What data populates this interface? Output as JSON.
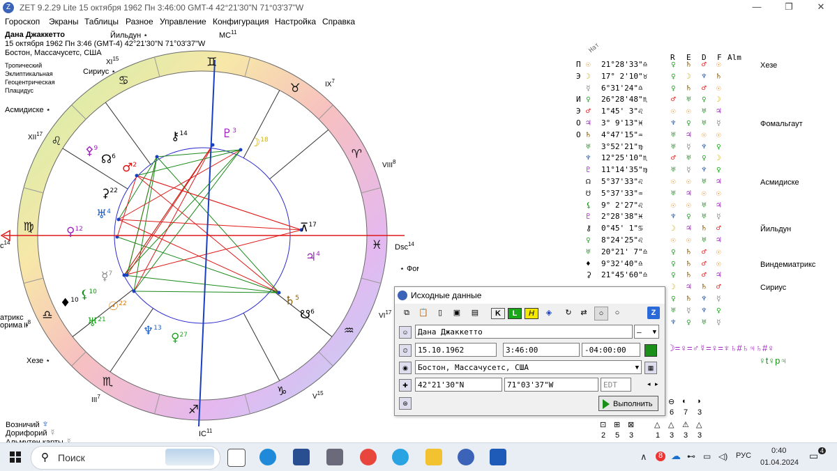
{
  "window": {
    "title": "ZET 9.2.29 Lite    15 октября 1962  Пн   3:46:00 GMT-4 42°21'30\"N  71°03'37\"W",
    "minimize": "—",
    "restore": "❐",
    "close": "✕"
  },
  "menu": [
    "Гороскоп",
    "Экраны",
    "Таблицы",
    "Разное",
    "Управление",
    "Конфигурация",
    "Настройка",
    "Справка"
  ],
  "chart_info": {
    "name": "Дана Джаккетто",
    "date_line": "15 октября 1962  Пн   3:46 (GMT-4) 42°21'30\"N  71°03'37\"W",
    "place": "Бостон, Массачусетс, США",
    "settings": [
      "Тропический",
      "Эклиптикальная",
      "Геоцентрическая",
      "Плацидус"
    ]
  },
  "wheel": {
    "star_labels": [
      {
        "id": "yildun",
        "text": "Йильдун ⋆"
      },
      {
        "id": "sirius",
        "text": "Сириус ⋆"
      },
      {
        "id": "asmidiske",
        "text": "Асмидиске ⋆"
      },
      {
        "id": "fomalhaut",
        "text": "⋆ Фомальгаут"
      },
      {
        "id": "atriks",
        "text": "атрикс"
      },
      {
        "id": "orima",
        "text": "орима ⋆"
      },
      {
        "id": "heze",
        "text": "Хезе ⋆"
      }
    ],
    "angle_labels": {
      "mc": "MC",
      "mc_deg": "11",
      "ic": "IC",
      "ic_deg": "11",
      "asc": "c",
      "asc_deg": "14",
      "dsc": "Dsc",
      "dsc_deg": "14"
    },
    "house_labels": [
      {
        "num": "XI",
        "deg": "15"
      },
      {
        "num": "IX",
        "deg": "7"
      },
      {
        "num": "XII",
        "deg": "17"
      },
      {
        "num": "VIII",
        "deg": "8"
      },
      {
        "num": "VI",
        "deg": "17"
      },
      {
        "num": "III",
        "deg": "7"
      },
      {
        "num": "V",
        "deg": "15"
      },
      {
        "num": "II",
        "deg": "8"
      }
    ],
    "signs_ring": [
      "♊",
      "♉",
      "♈",
      "♓",
      "♒",
      "♑",
      "♐",
      "♏",
      "♎",
      "♍",
      "♌",
      "♋"
    ],
    "planets": [
      {
        "glyph": "☉",
        "deg": "22",
        "color": "#e07a00"
      },
      {
        "glyph": "☽",
        "deg": "18",
        "color": "#d4b000"
      },
      {
        "glyph": "☿",
        "deg": "7",
        "color": "#888888"
      },
      {
        "glyph": "♀",
        "deg": "27",
        "color": "#1aa81a"
      },
      {
        "glyph": "♂",
        "deg": "2",
        "color": "#e01010"
      },
      {
        "glyph": "♃",
        "deg": "4",
        "color": "#a020c0"
      },
      {
        "glyph": "♄",
        "deg": "5",
        "color": "#8b5a00"
      },
      {
        "glyph": "♅",
        "deg": "4",
        "color": "#1a5fc8"
      },
      {
        "glyph": "♆",
        "deg": "13",
        "color": "#1a5fc8"
      },
      {
        "glyph": "♇",
        "deg": "3",
        "color": "#a020c0"
      },
      {
        "glyph": "☊",
        "deg": "6",
        "color": "#000000"
      },
      {
        "glyph": "☋",
        "deg": "6",
        "color": "#000000"
      },
      {
        "glyph": "⚸",
        "deg": "10",
        "color": "#1a8f1a"
      },
      {
        "glyph": "⚳",
        "deg": "22",
        "color": "#000000"
      },
      {
        "glyph": "♀",
        "deg": "12",
        "color": "#a020c0"
      },
      {
        "glyph": "⚷",
        "deg": "14",
        "color": "#000000"
      },
      {
        "glyph": "♅",
        "deg": "21",
        "color": "#1aa81a"
      },
      {
        "glyph": "⚴",
        "deg": "9",
        "color": "#a020c0"
      },
      {
        "glyph": "⊼",
        "deg": "17",
        "color": "#000000"
      },
      {
        "glyph": "♦",
        "deg": "10",
        "color": "#000000"
      }
    ]
  },
  "table": {
    "header_nat": "Нат",
    "col_headers": [
      "R",
      "E",
      "D",
      "F",
      "Alm"
    ],
    "rows": [
      {
        "pre": "П",
        "glyph": "☉",
        "pos": "21°28'33\"♎",
        "r": "♀",
        "e": "♄",
        "d": "♂",
        "f": "☉",
        "star": "Хезе"
      },
      {
        "pre": "Э",
        "glyph": "☽",
        "pos": "17° 2'10\"♉",
        "r": "♀",
        "e": "☽",
        "d": "♆",
        "f": "♄",
        "star": ""
      },
      {
        "pre": "",
        "glyph": "☿",
        "pos": " 6°31'24\"♎",
        "r": "♀",
        "e": "♄",
        "d": "♂",
        "f": "☉",
        "star": ""
      },
      {
        "pre": "И",
        "glyph": "♀",
        "pos": "26°28'48\"♏",
        "r": "♂",
        "e": "♅",
        "d": "♀",
        "f": "☽",
        "star": ""
      },
      {
        "pre": "Э",
        "glyph": "♂",
        "pos": " 1°45' 3\"♌",
        "r": "☉",
        "e": "☉",
        "d": "♅",
        "f": "♃",
        "star": ""
      },
      {
        "pre": "О",
        "glyph": "♃",
        "pos": " 3° 9'13\"♓",
        "r": "♆",
        "e": "♀",
        "d": "♅",
        "f": "☿",
        "star": "Фомальгаут"
      },
      {
        "pre": "О",
        "glyph": "♄",
        "pos": " 4°47'15\"♒",
        "r": "♅",
        "e": "♃",
        "d": "☉",
        "f": "☉",
        "star": ""
      },
      {
        "pre": "",
        "glyph": "♅",
        "pos": " 3°52'21\"♍",
        "r": "♅",
        "e": "☿",
        "d": "♆",
        "f": "♀",
        "star": ""
      },
      {
        "pre": "",
        "glyph": "♆",
        "pos": "12°25'10\"♏",
        "r": "♂",
        "e": "♅",
        "d": "♀",
        "f": "☽",
        "star": ""
      },
      {
        "pre": "",
        "glyph": "♇",
        "pos": "11°14'35\"♍",
        "r": "♅",
        "e": "☿",
        "d": "♆",
        "f": "♀",
        "star": ""
      },
      {
        "pre": "",
        "glyph": "☊",
        "pos": " 5°37'33\"♌",
        "r": "☉",
        "e": "☉",
        "d": "♅",
        "f": "♃",
        "star": "Асмидиске"
      },
      {
        "pre": "",
        "glyph": "☋",
        "pos": " 5°37'33\"♒",
        "r": "♅",
        "e": "♃",
        "d": "☉",
        "f": "☉",
        "star": ""
      },
      {
        "pre": "",
        "glyph": "⚸",
        "pos": " 9° 2'27\"♌",
        "r": "☉",
        "e": "☉",
        "d": "♅",
        "f": "♃",
        "star": ""
      },
      {
        "pre": "",
        "glyph": "♇",
        "pos": " 2°28'38\"♓",
        "r": "♆",
        "e": "♀",
        "d": "♅",
        "f": "☿",
        "star": ""
      },
      {
        "pre": "",
        "glyph": "⚷",
        "pos": " 0°45' 1\"♋",
        "r": "☽",
        "e": "♃",
        "d": "♄",
        "f": "♂",
        "star": "Йильдун"
      },
      {
        "pre": "",
        "glyph": "♀",
        "pos": " 8°24'25\"♌",
        "r": "☉",
        "e": "☉",
        "d": "♅",
        "f": "♃",
        "star": ""
      },
      {
        "pre": "",
        "glyph": "♅",
        "pos": "20°21' 7\"♎",
        "r": "♀",
        "e": "♄",
        "d": "♂",
        "f": "☉",
        "star": ""
      },
      {
        "pre": "",
        "glyph": "♦",
        "pos": " 9°32'40\"♎",
        "r": "♀",
        "e": "♄",
        "d": "♂",
        "f": "☉",
        "star": "Виндемиатрикс"
      },
      {
        "pre": "",
        "glyph": "⚳",
        "pos": "21°45'60\"♎",
        "r": "♀",
        "e": "♄",
        "d": "♂",
        "f": "♃",
        "star": ""
      },
      {
        "pre": "",
        "glyph": "",
        "pos": "",
        "r": "☽",
        "e": "♃",
        "d": "♄",
        "f": "♂",
        "star": "Сириус"
      },
      {
        "pre": "",
        "glyph": "",
        "pos": "",
        "r": "♀",
        "e": "♄",
        "d": "♆",
        "f": "☿",
        "star": ""
      },
      {
        "pre": "",
        "glyph": "",
        "pos": "",
        "r": "♅",
        "e": "☿",
        "d": "♆",
        "f": "♀",
        "star": ""
      },
      {
        "pre": "",
        "glyph": "",
        "pos": "",
        "r": "♆",
        "e": "♀",
        "d": "♅",
        "f": "☿",
        "star": ""
      }
    ]
  },
  "aspect_formula": {
    "line1": "☽=♀=♂☿=♀=♆♄#♄♃♄#♀",
    "line2": "♀t♀p♃"
  },
  "counters": {
    "row1_icons": [
      "⊖",
      "◐",
      "◑"
    ],
    "row1_vals": [
      "6",
      "7",
      "3"
    ],
    "row2_icons_left": [
      "⊡",
      "⊞",
      "⊠"
    ],
    "row2_vals_left": [
      "2",
      "5",
      "3"
    ],
    "row2_icons_right": [
      "△",
      "△",
      "⚠",
      "△"
    ],
    "row2_vals_right": [
      "1",
      "3",
      "3",
      "3"
    ]
  },
  "bottom_left": {
    "lines": [
      {
        "label": "Возничий",
        "glyph": "♆"
      },
      {
        "label": "Дорифорий",
        "glyph": "☿"
      },
      {
        "label": "Альмутен карты",
        "glyph": "☿"
      }
    ]
  },
  "dialog": {
    "title": "Исходные данные",
    "name_value": "Дана Джаккетто",
    "gender_value": "—",
    "date_value": "15.10.1962",
    "time_value": "3:46:00",
    "tz_value": "-04:00:00",
    "place_value": "Бостон, Массачусетс, США",
    "lat_value": "42°21'30\"N",
    "lon_value": "71°03'37\"W",
    "dst_value": "EDT",
    "run_label": "Выполнить"
  },
  "taskbar": {
    "search_label": "Поиск",
    "lang": "РУС",
    "time": "0:40",
    "date": "01.04.2024",
    "notifications": "4"
  },
  "colors": {
    "aspect_red": "#e01818",
    "aspect_green": "#1a8a1a",
    "axis_blue": "#1a3fbf",
    "axis_red": "#e01818"
  }
}
